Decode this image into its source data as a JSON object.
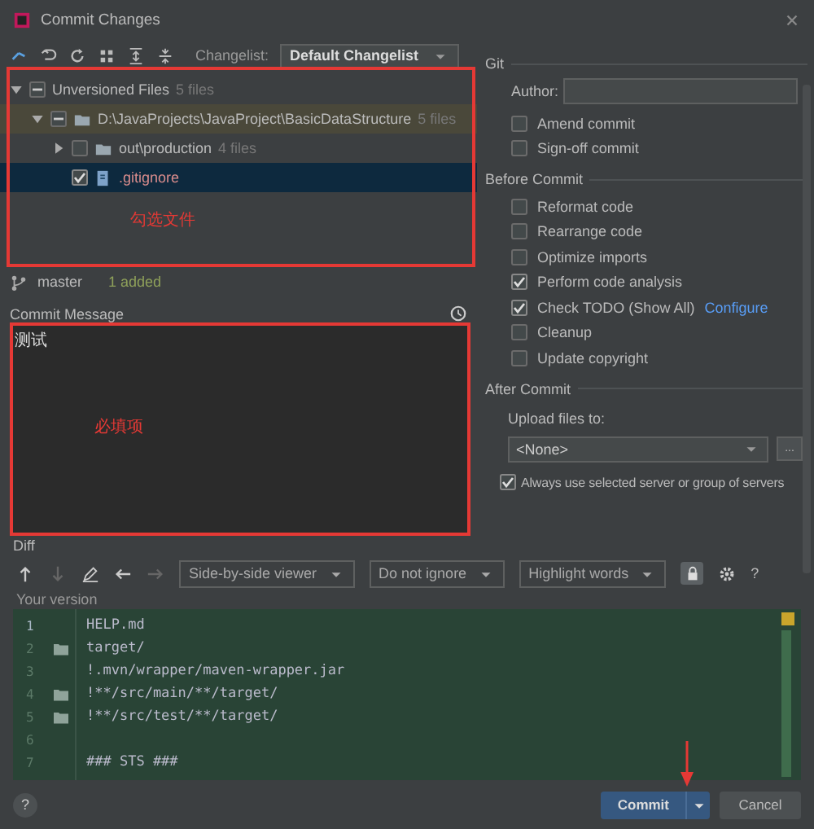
{
  "window": {
    "title": "Commit Changes"
  },
  "toolbar": {
    "changelist_label": "Changelist:",
    "changelist_value": "Default Changelist"
  },
  "tree": [
    {
      "label": "Unversioned Files",
      "count": "5 files",
      "checked": false,
      "partial": true,
      "expanded": true,
      "selected": false,
      "children": [
        {
          "label": "D:\\JavaProjects\\JavaProject\\BasicDataStructure",
          "count": "5 files",
          "kind": "folder",
          "checked": false,
          "partial": true,
          "expanded": true,
          "selected": false,
          "children": [
            {
              "label": "out\\production",
              "count": "4 files",
              "kind": "folder",
              "checked": false,
              "partial": false,
              "expanded": false,
              "selected": false
            },
            {
              "label": ".gitignore",
              "kind": "file",
              "checked": true,
              "partial": false,
              "selected": true
            }
          ]
        }
      ]
    }
  ],
  "branch": {
    "name": "master",
    "status": "1 added"
  },
  "commit_message": {
    "label": "Commit Message",
    "value": "测试"
  },
  "annotations": [
    {
      "text": "勾选文件"
    },
    {
      "text": "必填项"
    }
  ],
  "git": {
    "title": "Git",
    "author_label": "Author:",
    "options": [
      {
        "label": "Amend commit",
        "checked": false
      },
      {
        "label": "Sign-off commit",
        "checked": false
      }
    ]
  },
  "before_commit": {
    "title": "Before Commit",
    "options": [
      {
        "label": "Reformat code",
        "checked": false
      },
      {
        "label": "Rearrange code",
        "checked": false
      },
      {
        "label": "Optimize imports",
        "checked": false
      },
      {
        "label": "Perform code analysis",
        "checked": true
      },
      {
        "label": "Check TODO (Show All)",
        "link": "Configure",
        "checked": true
      },
      {
        "label": "Cleanup",
        "checked": false
      },
      {
        "label": "Update copyright",
        "checked": false
      }
    ]
  },
  "after_commit": {
    "title": "After Commit",
    "upload_label": "Upload files to:",
    "server": "<None>",
    "browse": "...",
    "option": {
      "label": "Always use selected server or group of servers",
      "checked": true
    }
  },
  "diff": {
    "label": "Diff",
    "viewer": "Side-by-side viewer",
    "ignore": "Do not ignore",
    "highlight": "Highlight words",
    "help": "?",
    "version_label": "Your version",
    "lines": [
      {
        "number": "1",
        "text": "HELP.md",
        "folder": false
      },
      {
        "number": "2",
        "text": "target/",
        "folder": true
      },
      {
        "number": "3",
        "text": "!.mvn/wrapper/maven-wrapper.jar",
        "folder": false
      },
      {
        "number": "4",
        "text": "!**/src/main/**/target/",
        "folder": true
      },
      {
        "number": "5",
        "text": "!**/src/test/**/target/",
        "folder": true
      },
      {
        "number": "6",
        "folder": false
      },
      {
        "number": "7",
        "text": "### STS ###",
        "folder": false
      }
    ]
  },
  "buttons": {
    "help": "?",
    "commit": "Commit",
    "cancel": "Cancel"
  }
}
